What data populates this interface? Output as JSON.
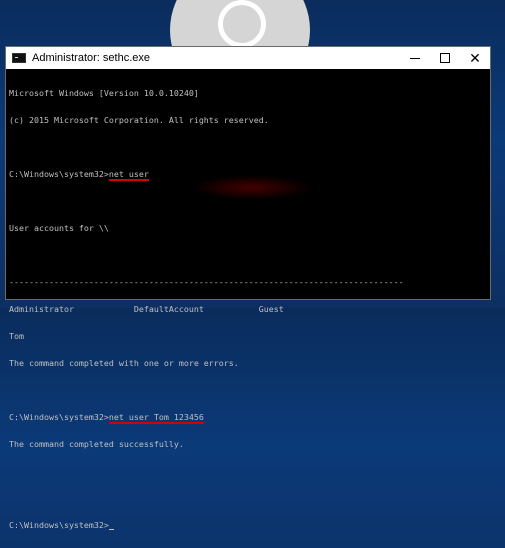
{
  "window": {
    "title": "Administrator: sethc.exe",
    "controls": {
      "minimize": "—",
      "maximize": "☐",
      "close": "✕"
    }
  },
  "console": {
    "lines": [
      "Microsoft Windows [Version 10.0.10240]",
      "(c) 2015 Microsoft Corporation. All rights reserved.",
      "",
      "C:\\Windows\\system32>net user",
      "",
      "User accounts for \\\\",
      "",
      "-------------------------------------------------------------------------------",
      "Administrator            DefaultAccount           Guest",
      "Tom",
      "The command completed with one or more errors.",
      "",
      "C:\\Windows\\system32>net user Tom 123456",
      "The command completed successfully.",
      "",
      "",
      "C:\\Windows\\system32>"
    ],
    "cmd1": "net user",
    "cmd2": "net user Tom 123456",
    "prompt": "C:\\Windows\\system32>"
  },
  "colors": {
    "accent_underline": "#d40000",
    "console_text": "#c0c0c0",
    "console_bg": "#000000",
    "desktop": "#0b3a78"
  }
}
